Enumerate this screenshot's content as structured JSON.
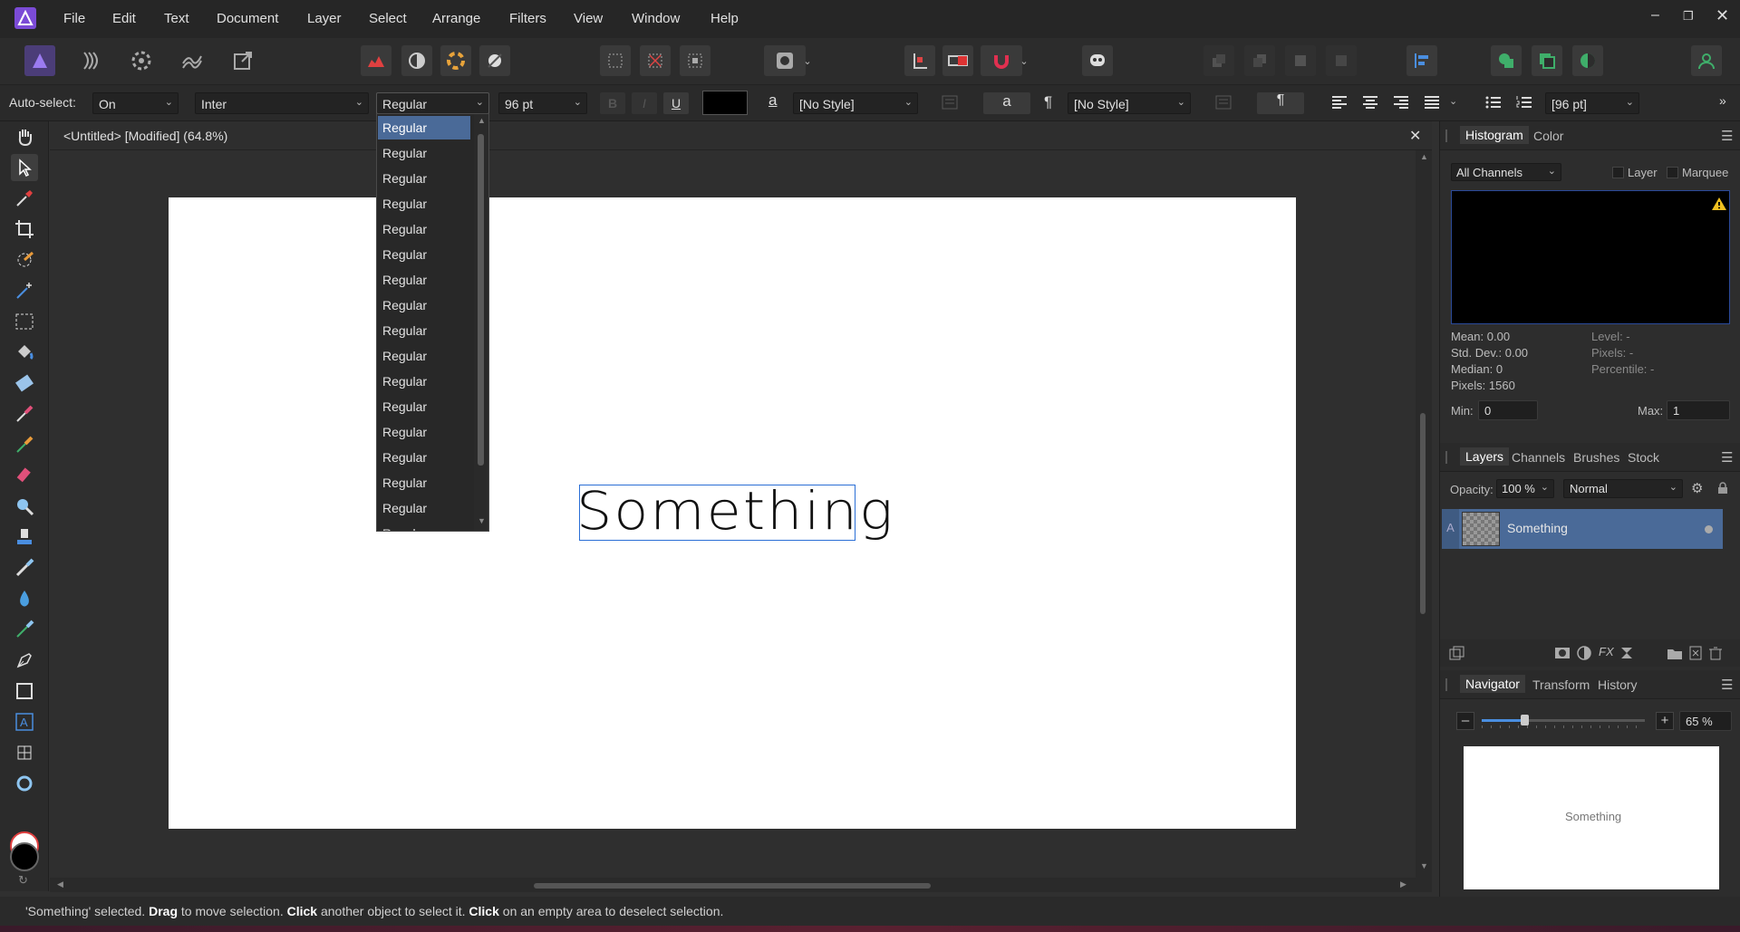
{
  "menu": {
    "items": [
      "File",
      "Edit",
      "Text",
      "Document",
      "Layer",
      "Select",
      "Arrange",
      "Filters",
      "View",
      "Window",
      "Help"
    ]
  },
  "context": {
    "autoselect_label": "Auto-select:",
    "autoselect_value": "On",
    "font_family": "Inter",
    "font_style": "Regular",
    "font_size": "96 pt",
    "bold": "B",
    "italic": "I",
    "underline": "U",
    "char_style_icon": "a",
    "char_style": "[No Style]",
    "para_icon": "¶",
    "para_style": "[No Style]",
    "leading": "[96 pt]"
  },
  "dropdown": {
    "items": [
      "Regular",
      "Regular",
      "Regular",
      "Regular",
      "Regular",
      "Regular",
      "Regular",
      "Regular",
      "Regular",
      "Regular",
      "Regular",
      "Regular",
      "Regular",
      "Regular",
      "Regular",
      "Regular",
      "Regular"
    ]
  },
  "document": {
    "tab_title": "<Untitled> [Modified] (64.8%)",
    "text_object": "Something"
  },
  "status": {
    "part1": "'Something' selected. ",
    "b1": "Drag",
    "part2": " to move selection. ",
    "b2": "Click",
    "part3": " another object to select it. ",
    "b3": "Click",
    "part4": " on an empty area to deselect selection."
  },
  "histogram": {
    "tab_histogram": "Histogram",
    "tab_color": "Color",
    "channels": "All Channels",
    "layer_label": "Layer",
    "marquee_label": "Marquee",
    "mean": "Mean: 0.00",
    "stddev": "Std. Dev.: 0.00",
    "median": "Median: 0",
    "pixels": "Pixels: 1560",
    "level": "Level: -",
    "pixels_r": "Pixels: -",
    "percentile": "Percentile: -",
    "min_label": "Min:",
    "min_value": "0",
    "max_label": "Max:",
    "max_value": "1"
  },
  "layers": {
    "tabs": [
      "Layers",
      "Channels",
      "Brushes",
      "Stock"
    ],
    "opacity_label": "Opacity:",
    "opacity_value": "100 %",
    "blend_mode": "Normal",
    "layer_type": "A",
    "layer_name": "Something"
  },
  "navigator": {
    "tabs": [
      "Navigator",
      "Transform",
      "History"
    ],
    "zoom_value": "65 %",
    "preview_text": "Something",
    "zoom_fraction": 0.26
  },
  "colors": {
    "accent": "#4a6a98",
    "selection_blue": "#2b6fd6"
  }
}
